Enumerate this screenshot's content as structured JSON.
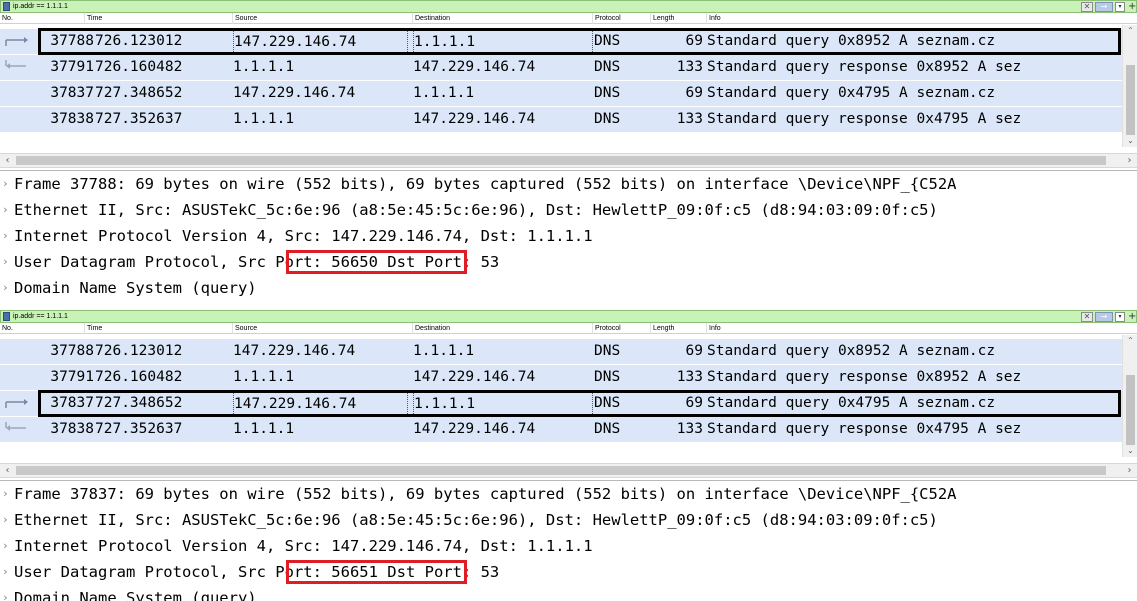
{
  "filter": {
    "text": "ip.addr == 1.1.1.1"
  },
  "columns": [
    "No.",
    "Time",
    "Source",
    "Destination",
    "Protocol",
    "Length",
    "Info"
  ],
  "icons": {
    "clear": "clear-filter-icon",
    "apply": "apply-filter-icon",
    "dropdown": "dropdown-icon",
    "add": "plus-icon",
    "arrow": "request-arrow-icon",
    "expand": "expand-chevron-icon"
  },
  "colors": {
    "row_bg": "#dbe7f8",
    "filter_bg": "#c9f3b6",
    "highlight": "#000000",
    "annotation": "#e01d24"
  },
  "glyphs": {
    "expand": "›",
    "up": "⌃",
    "down": "⌄",
    "left": "‹",
    "right": "›",
    "plus": "+",
    "clear": "✕",
    "apply": "→",
    "dropdown": "▾"
  },
  "pane_a": {
    "packets": [
      {
        "no": "37788",
        "time": "726.123012",
        "src": "147.229.146.74",
        "dst": "1.1.1.1",
        "proto": "DNS",
        "len": "69",
        "info": "Standard query 0x8952 A seznam.cz"
      },
      {
        "no": "37791",
        "time": "726.160482",
        "src": "1.1.1.1",
        "dst": "147.229.146.74",
        "proto": "DNS",
        "len": "133",
        "info": "Standard query response 0x8952 A sez"
      },
      {
        "no": "37837",
        "time": "727.348652",
        "src": "147.229.146.74",
        "dst": "1.1.1.1",
        "proto": "DNS",
        "len": "69",
        "info": "Standard query 0x4795 A seznam.cz"
      },
      {
        "no": "37838",
        "time": "727.352637",
        "src": "1.1.1.1",
        "dst": "147.229.146.74",
        "proto": "DNS",
        "len": "133",
        "info": "Standard query response 0x4795 A sez"
      }
    ],
    "details": {
      "frame": "Frame 37788: 69 bytes on wire (552 bits), 69 bytes captured (552 bits) on interface \\Device\\NPF_{C52A",
      "ethernet": "Ethernet II, Src: ASUSTekC_5c:6e:96 (a8:5e:45:5c:6e:96), Dst: HewlettP_09:0f:c5 (d8:94:03:09:0f:c5)",
      "ip": "Internet Protocol Version 4, Src: 147.229.146.74, Dst: 1.1.1.1",
      "udp_prefix": "User Datagram Protocol, ",
      "udp_src": "Src Port: 56650",
      "udp_suffix": " Dst Port: 53",
      "dns": "Domain Name System (query)"
    }
  },
  "pane_b": {
    "packets": [
      {
        "no": "37788",
        "time": "726.123012",
        "src": "147.229.146.74",
        "dst": "1.1.1.1",
        "proto": "DNS",
        "len": "69",
        "info": "Standard query 0x8952 A seznam.cz"
      },
      {
        "no": "37791",
        "time": "726.160482",
        "src": "1.1.1.1",
        "dst": "147.229.146.74",
        "proto": "DNS",
        "len": "133",
        "info": "Standard query response 0x8952 A sez"
      },
      {
        "no": "37837",
        "time": "727.348652",
        "src": "147.229.146.74",
        "dst": "1.1.1.1",
        "proto": "DNS",
        "len": "69",
        "info": "Standard query 0x4795 A seznam.cz"
      },
      {
        "no": "37838",
        "time": "727.352637",
        "src": "1.1.1.1",
        "dst": "147.229.146.74",
        "proto": "DNS",
        "len": "133",
        "info": "Standard query response 0x4795 A sez"
      }
    ],
    "details": {
      "frame": "Frame 37837: 69 bytes on wire (552 bits), 69 bytes captured (552 bits) on interface \\Device\\NPF_{C52A",
      "ethernet": "Ethernet II, Src: ASUSTekC_5c:6e:96 (a8:5e:45:5c:6e:96), Dst: HewlettP_09:0f:c5 (d8:94:03:09:0f:c5)",
      "ip": "Internet Protocol Version 4, Src: 147.229.146.74, Dst: 1.1.1.1",
      "udp_prefix": "User Datagram Protocol, ",
      "udp_src": "Src Port: 56651",
      "udp_suffix": " Dst Port: 53",
      "dns": "Domain Name System (query)"
    }
  }
}
